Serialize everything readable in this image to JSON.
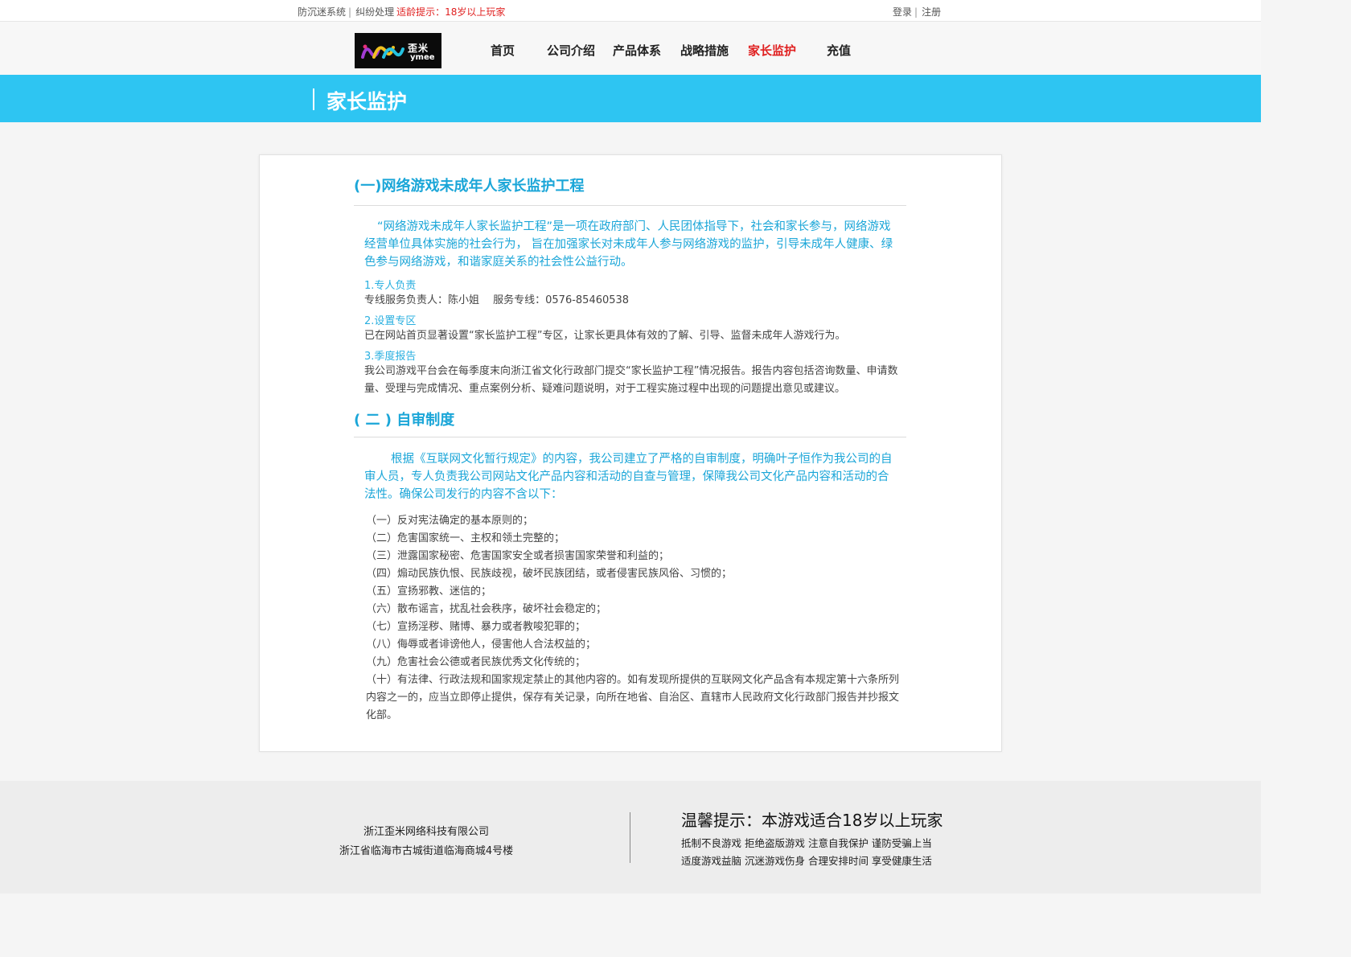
{
  "topbar": {
    "left_links": [
      "防沉迷系统",
      "纠纷处理"
    ],
    "separator": "|",
    "age_warning": "适龄提示：18岁以上玩家",
    "right_links": [
      "登录",
      "注册"
    ]
  },
  "logo": {
    "cn": "歪米",
    "en": "ymee"
  },
  "nav": {
    "items": [
      "首页",
      "公司介绍",
      "产品体系",
      "战略措施",
      "家长监护",
      "充值"
    ],
    "active": "家长监护"
  },
  "banner": {
    "title": "家长监护"
  },
  "content": {
    "section1": {
      "title": "(一)网络游戏未成年人家长监护工程",
      "lead": "“网络游戏未成年人家长监护工程”是一项在政府部门、人民团体指导下，社会和家长参与，网络游戏经营单位具体实施的社会行为， 旨在加强家长对未成年人参与网络游戏的监护，引导未成年人健康、绿色参与网络游戏，和谐家庭关系的社会性公益行动。",
      "items": [
        {
          "heading": "1.专人负责",
          "text": "专线服务负责人：陈小姐　 服务专线：0576-85460538"
        },
        {
          "heading": "2.设置专区",
          "text": "已在网站首页显著设置“家长监护工程”专区，让家长更具体有效的了解、引导、监督未成年人游戏行为。"
        },
        {
          "heading": "3.季度报告",
          "text": "我公司游戏平台会在每季度末向浙江省文化行政部门提交“家长监护工程”情况报告。报告内容包括咨询数量、申请数量、受理与完成情况、重点案例分析、疑难问题说明，对于工程实施过程中出现的问题提出意见或建议。"
        }
      ]
    },
    "section2": {
      "title": "( 二 ) 自审制度",
      "lead": "根据《互联网文化暂行规定》的内容，我公司建立了严格的自审制度，明确叶子恒作为我公司的自审人员，专人负责我公司网站文化产品内容和活动的自查与管理，保障我公司文化产品内容和活动的合法性。确保公司发行的内容不含以下：",
      "list": [
        "（一）反对宪法确定的基本原则的；",
        "（二）危害国家统一、主权和领土完整的；",
        "（三）泄露国家秘密、危害国家安全或者损害国家荣誉和利益的；",
        "（四）煽动民族仇恨、民族歧视，破坏民族团结，或者侵害民族风俗、习惯的；",
        "（五）宣扬邪教、迷信的；",
        "（六）散布谣言，扰乱社会秩序，破坏社会稳定的；",
        "（七）宣扬淫秽、赌博、暴力或者教唆犯罪的；",
        "（八）侮辱或者诽谤他人，侵害他人合法权益的；",
        "（九）危害社会公德或者民族优秀文化传统的；",
        "（十）有法律、行政法规和国家规定禁止的其他内容的。如有发现所提供的互联网文化产品含有本规定第十六条所列内容之一的，应当立即停止提供，保存有关记录，向所在地省、自治区、直辖市人民政府文化行政部门报告并抄报文化部。"
      ]
    }
  },
  "footer": {
    "company": "浙江歪米网络科技有限公司",
    "address": "浙江省临海市古城街道临海商城4号楼",
    "tip": "温馨提示：本游戏适合18岁以上玩家",
    "line1": "抵制不良游戏 拒绝盗版游戏 注意自我保护 谨防受骗上当",
    "line2": "适度游戏益脑 沉迷游戏伤身 合理安排时间 享受健康生活"
  },
  "colors": {
    "accent": "#2ec5f2",
    "heading": "#1ba6d8",
    "active_nav": "#e02020",
    "warning": "#e02020"
  }
}
